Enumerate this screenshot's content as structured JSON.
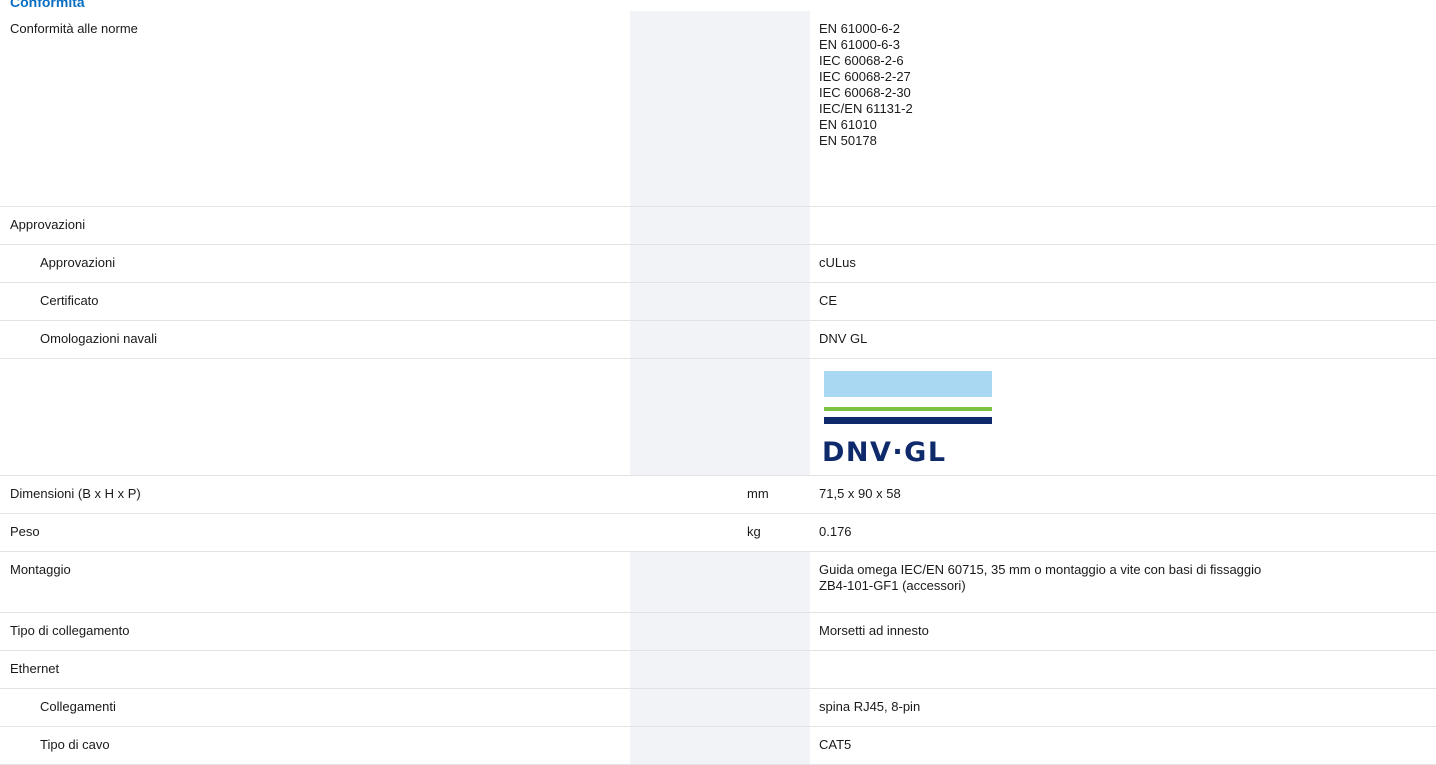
{
  "section": {
    "title": "Conformità"
  },
  "rows": [
    {
      "label": "Conformità alle norme",
      "unit": "",
      "values": [
        "EN 61000-6-2",
        "EN 61000-6-3",
        "IEC 60068-2-6",
        "IEC 60068-2-27",
        "IEC 60068-2-30",
        "IEC/EN 61131-2",
        "EN 61010",
        "EN 50178"
      ]
    },
    {
      "label": "Approvazioni",
      "unit": "",
      "values": []
    },
    {
      "label": "Approvazioni",
      "unit": "",
      "values": [
        "cULus"
      ]
    },
    {
      "label": "Certificato",
      "unit": "",
      "values": [
        "CE"
      ]
    },
    {
      "label": "Omologazioni navali",
      "unit": "",
      "values": [
        "DNV GL"
      ]
    },
    {
      "label": "",
      "unit": "",
      "values": []
    },
    {
      "label": "Dimensioni (B x H x P)",
      "unit": "mm",
      "values": [
        "71,5 x 90 x 58"
      ]
    },
    {
      "label": "Peso",
      "unit": "kg",
      "values": [
        "0.176"
      ]
    },
    {
      "label": "Montaggio",
      "unit": "",
      "values": [
        "Guida omega IEC/EN 60715, 35 mm o montaggio a vite con basi di fissaggio",
        "ZB4-101-GF1 (accessori)"
      ]
    },
    {
      "label": "Tipo di collegamento",
      "unit": "",
      "values": [
        "Morsetti ad innesto"
      ]
    },
    {
      "label": "Ethernet",
      "unit": "",
      "values": []
    },
    {
      "label": "Collegamenti",
      "unit": "",
      "values": [
        "spina RJ45, 8-pin"
      ]
    },
    {
      "label": "Tipo di cavo",
      "unit": "",
      "values": [
        "CAT5"
      ]
    }
  ],
  "logo": {
    "text": "DNV·GL",
    "colors": {
      "sky": "#a9d8f2",
      "green": "#7cc242",
      "navy": "#0f2a6b"
    }
  }
}
